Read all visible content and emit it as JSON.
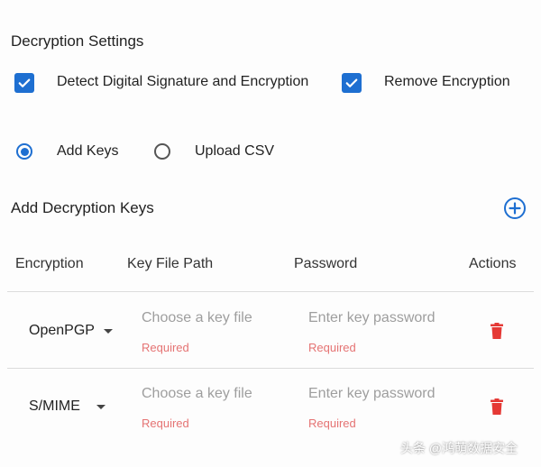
{
  "settings": {
    "title": "Decryption Settings",
    "detect_label": "Detect Digital Signature and Encryption",
    "detect_checked": true,
    "remove_label": "Remove Encryption",
    "remove_checked": true
  },
  "mode": {
    "options": [
      "Add Keys",
      "Upload CSV"
    ],
    "selected": "Add Keys"
  },
  "keys": {
    "title": "Add Decryption Keys",
    "columns": [
      "Encryption",
      "Key File Path",
      "Password",
      "Actions"
    ],
    "rows": [
      {
        "encryption": "OpenPGP",
        "key_placeholder": "Choose a key file",
        "key_error": "Required",
        "password_placeholder": "Enter key password",
        "password_error": "Required"
      },
      {
        "encryption": "S/MIME",
        "key_placeholder": "Choose a key file",
        "key_error": "Required",
        "password_placeholder": "Enter key password",
        "password_error": "Required"
      }
    ]
  },
  "colors": {
    "accent": "#1e6fd1",
    "error": "#e57373",
    "delete": "#e53935"
  },
  "icons": {
    "add": "add-circle-icon",
    "delete": "trash-icon",
    "dropdown": "caret-down-icon"
  },
  "watermark": "头条 @鸿萌数据安全"
}
